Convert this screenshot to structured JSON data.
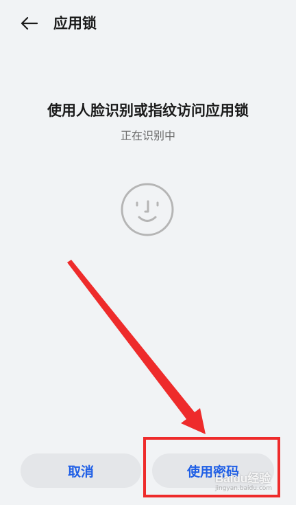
{
  "header": {
    "title": "应用锁",
    "back_icon": "arrow-left-icon"
  },
  "main": {
    "heading": "使用人脸识别或指纹访问应用锁",
    "status": "正在识别中",
    "face_icon": "face-recognition-icon"
  },
  "actions": {
    "cancel_label": "取消",
    "use_password_label": "使用密码"
  },
  "annotation": {
    "color": "#ee2b2b"
  },
  "watermark": {
    "logo": "Baidu经验",
    "url": "jingyan.baidu.com"
  },
  "colors": {
    "background": "#f1f3f5",
    "button_bg": "#e4e6e9",
    "accent": "#1f5fe6"
  }
}
